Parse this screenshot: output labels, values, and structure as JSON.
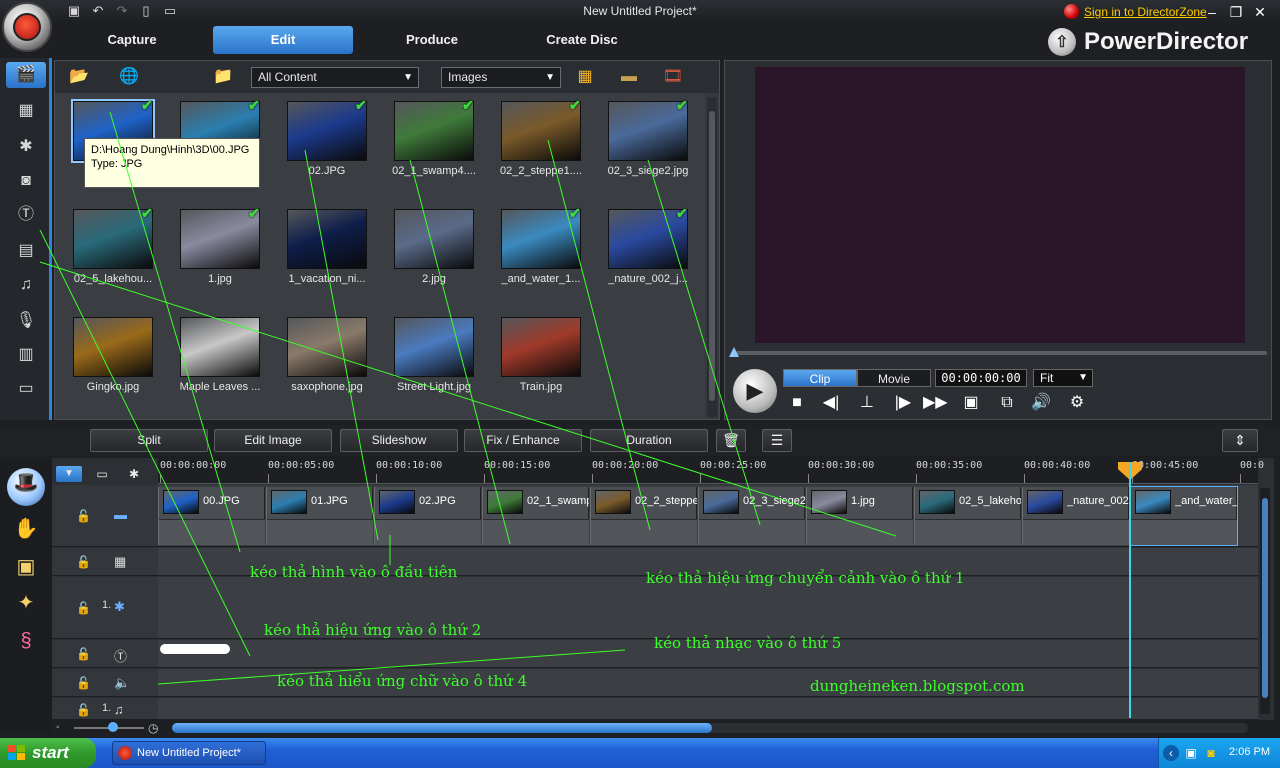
{
  "window": {
    "title": "New Untitled Project*"
  },
  "signin": {
    "link": "Sign in to DirectorZone"
  },
  "tabs": [
    {
      "label": "Capture"
    },
    {
      "label": "Edit"
    },
    {
      "label": "Produce"
    },
    {
      "label": "Create Disc"
    }
  ],
  "active_tab": "Edit",
  "brand": {
    "name": "PowerDirector"
  },
  "library": {
    "filter": "All Content",
    "type": "Images",
    "tooltip": {
      "path": "D:\\Hoang Dung\\Hinh\\3D\\00.JPG",
      "type": "Type: JPG"
    },
    "items": [
      {
        "label": "",
        "checked": true,
        "color": "#1f62c8"
      },
      {
        "label": "",
        "checked": true,
        "color": "#2a7fb0"
      },
      {
        "label": "02.JPG",
        "checked": true,
        "color": "#1c3a8c"
      },
      {
        "label": "02_1_swamp4....",
        "checked": true,
        "color": "#3f7a3a"
      },
      {
        "label": "02_2_steppe1....",
        "checked": true,
        "color": "#7a5a2a"
      },
      {
        "label": "02_3_siege2.jpg",
        "checked": true,
        "color": "#4a6a9a"
      },
      {
        "label": "02_5_lakehou...",
        "checked": true,
        "color": "#2a6a7a"
      },
      {
        "label": "1.jpg",
        "checked": true,
        "color": "#8a8aa0"
      },
      {
        "label": "1_vacation_ni...",
        "checked": false,
        "color": "#0e1e4a"
      },
      {
        "label": "2.jpg",
        "checked": false,
        "color": "#5a6a8a"
      },
      {
        "label": "_and_water_1...",
        "checked": true,
        "color": "#3a8ac0"
      },
      {
        "label": "_nature_002_j...",
        "checked": true,
        "color": "#2a4aa0"
      },
      {
        "label": "Gingko.jpg",
        "checked": false,
        "color": "#9a6a1a"
      },
      {
        "label": "Maple Leaves ...",
        "checked": false,
        "color": "#c8c8c8"
      },
      {
        "label": "saxophone.jpg",
        "checked": false,
        "color": "#8a7a6a"
      },
      {
        "label": "Street Light.jpg",
        "checked": false,
        "color": "#4a7ac0"
      },
      {
        "label": "Train.jpg",
        "checked": false,
        "color": "#a03a2a"
      }
    ]
  },
  "preview": {
    "modes": [
      "Clip",
      "Movie"
    ],
    "active_mode": "Clip",
    "timecode": "00:00:00:00",
    "fit": "Fit"
  },
  "edit_buttons": [
    "Split",
    "Edit Image",
    "Slideshow",
    "Fix / Enhance",
    "Duration"
  ],
  "timeline": {
    "ticks": [
      "00:00:00:00",
      "00:00:05:00",
      "00:00:10:00",
      "00:00:15:00",
      "00:00:20:00",
      "00:00:25:00",
      "00:00:30:00",
      "00:00:35:00",
      "00:00:40:00",
      "00:00:45:00",
      "00:0"
    ],
    "track_numbers": {
      "effect": "1.",
      "music": "1."
    },
    "clips": [
      {
        "label": "00.JPG",
        "color": "#1f62c8"
      },
      {
        "label": "01.JPG",
        "color": "#2a7fb0"
      },
      {
        "label": "02.JPG",
        "color": "#1c3a8c"
      },
      {
        "label": "02_1_swamp",
        "color": "#3f7a3a"
      },
      {
        "label": "02_2_steppe",
        "color": "#7a5a2a"
      },
      {
        "label": "02_3_siege2",
        "color": "#4a6a9a"
      },
      {
        "label": "1.jpg",
        "color": "#8a8aa0"
      },
      {
        "label": "02_5_lakeho",
        "color": "#2a6a7a"
      },
      {
        "label": "_nature_002",
        "color": "#2a4aa0"
      },
      {
        "label": "_and_water_",
        "color": "#3a8ac0"
      }
    ]
  },
  "annotations": {
    "a1": "kéo thả hình vào ô đầu tiên",
    "a2": "kéo thả hiệu ứng chuyển cảnh vào ô thứ 1",
    "a3": "kéo thả hiệu ứng vào ô thứ  2",
    "a4": "kéo thả nhạc vào ô thứ 5",
    "a5": "kéo thả hiểu ứng chữ vào ô thứ  4",
    "a6": "dungheineken.blogspot.com"
  },
  "taskbar": {
    "start": "start",
    "task": "New Untitled Project*",
    "clock": "2:06 PM"
  }
}
